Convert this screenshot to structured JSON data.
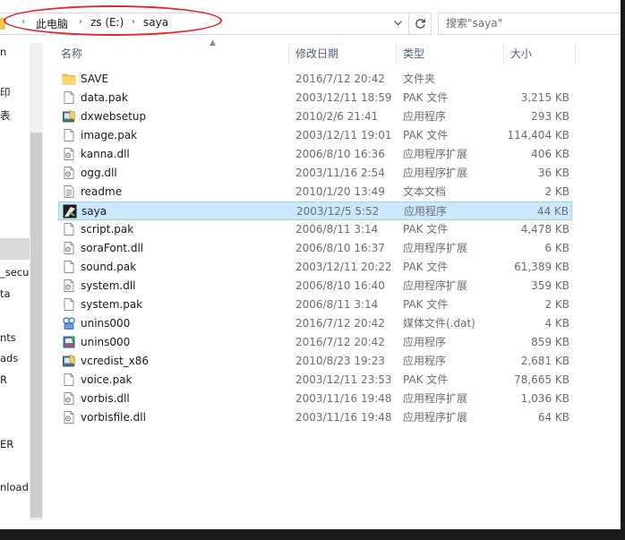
{
  "address": {
    "crumbs": [
      "此电脑",
      "zs (E:)",
      "saya"
    ],
    "arrow": "›"
  },
  "search": {
    "placeholder": "搜索\"saya\""
  },
  "nav": {
    "items": [
      "n",
      "印",
      "表",
      "_secu",
      "ta",
      "nts",
      "ads",
      "R",
      "ER",
      "nload"
    ]
  },
  "columns": {
    "name": "名称",
    "date": "修改日期",
    "type": "类型",
    "size": "大小"
  },
  "files": [
    {
      "name": "SAVE",
      "date": "2016/7/12 20:42",
      "type": "文件夹",
      "size": "",
      "icon": "folder-icon"
    },
    {
      "name": "data.pak",
      "date": "2003/12/11 18:59",
      "type": "PAK 文件",
      "size": "3,215 KB",
      "icon": "file-icon"
    },
    {
      "name": "dxwebsetup",
      "date": "2010/2/6 21:41",
      "type": "应用程序",
      "size": "293 KB",
      "icon": "installer-icon"
    },
    {
      "name": "image.pak",
      "date": "2003/12/11 19:01",
      "type": "PAK 文件",
      "size": "114,404 KB",
      "icon": "file-icon"
    },
    {
      "name": "kanna.dll",
      "date": "2006/8/10 16:36",
      "type": "应用程序扩展",
      "size": "406 KB",
      "icon": "dll-icon"
    },
    {
      "name": "ogg.dll",
      "date": "2003/11/16 2:54",
      "type": "应用程序扩展",
      "size": "36 KB",
      "icon": "dll-icon"
    },
    {
      "name": "readme",
      "date": "2010/1/20 13:49",
      "type": "文本文档",
      "size": "2 KB",
      "icon": "text-file-icon"
    },
    {
      "name": "saya",
      "date": "2003/12/5 5:52",
      "type": "应用程序",
      "size": "44 KB",
      "icon": "app-icon",
      "selected": true
    },
    {
      "name": "script.pak",
      "date": "2006/8/11 3:14",
      "type": "PAK 文件",
      "size": "4,478 KB",
      "icon": "file-icon"
    },
    {
      "name": "soraFont.dll",
      "date": "2006/8/10 16:37",
      "type": "应用程序扩展",
      "size": "6 KB",
      "icon": "dll-icon"
    },
    {
      "name": "sound.pak",
      "date": "2003/12/11 20:22",
      "type": "PAK 文件",
      "size": "61,389 KB",
      "icon": "file-icon"
    },
    {
      "name": "system.dll",
      "date": "2006/8/10 16:40",
      "type": "应用程序扩展",
      "size": "359 KB",
      "icon": "dll-icon"
    },
    {
      "name": "system.pak",
      "date": "2006/8/11 3:14",
      "type": "PAK 文件",
      "size": "2 KB",
      "icon": "file-icon"
    },
    {
      "name": "unins000",
      "date": "2016/7/12 20:42",
      "type": "媒体文件(.dat)",
      "size": "4 KB",
      "icon": "media-file-icon"
    },
    {
      "name": "unins000",
      "date": "2016/7/12 20:42",
      "type": "应用程序",
      "size": "859 KB",
      "icon": "uninstaller-icon"
    },
    {
      "name": "vcredist_x86",
      "date": "2010/8/23 19:23",
      "type": "应用程序",
      "size": "2,681 KB",
      "icon": "installer-icon"
    },
    {
      "name": "voice.pak",
      "date": "2003/12/11 23:53",
      "type": "PAK 文件",
      "size": "78,665 KB",
      "icon": "file-icon"
    },
    {
      "name": "vorbis.dll",
      "date": "2003/11/16 19:48",
      "type": "应用程序扩展",
      "size": "1,036 KB",
      "icon": "dll-icon"
    },
    {
      "name": "vorbisfile.dll",
      "date": "2003/11/16 19:48",
      "type": "应用程序扩展",
      "size": "64 KB",
      "icon": "dll-icon"
    }
  ],
  "colors": {
    "selection": "#cce8ff",
    "annotation": "#e0252d"
  }
}
